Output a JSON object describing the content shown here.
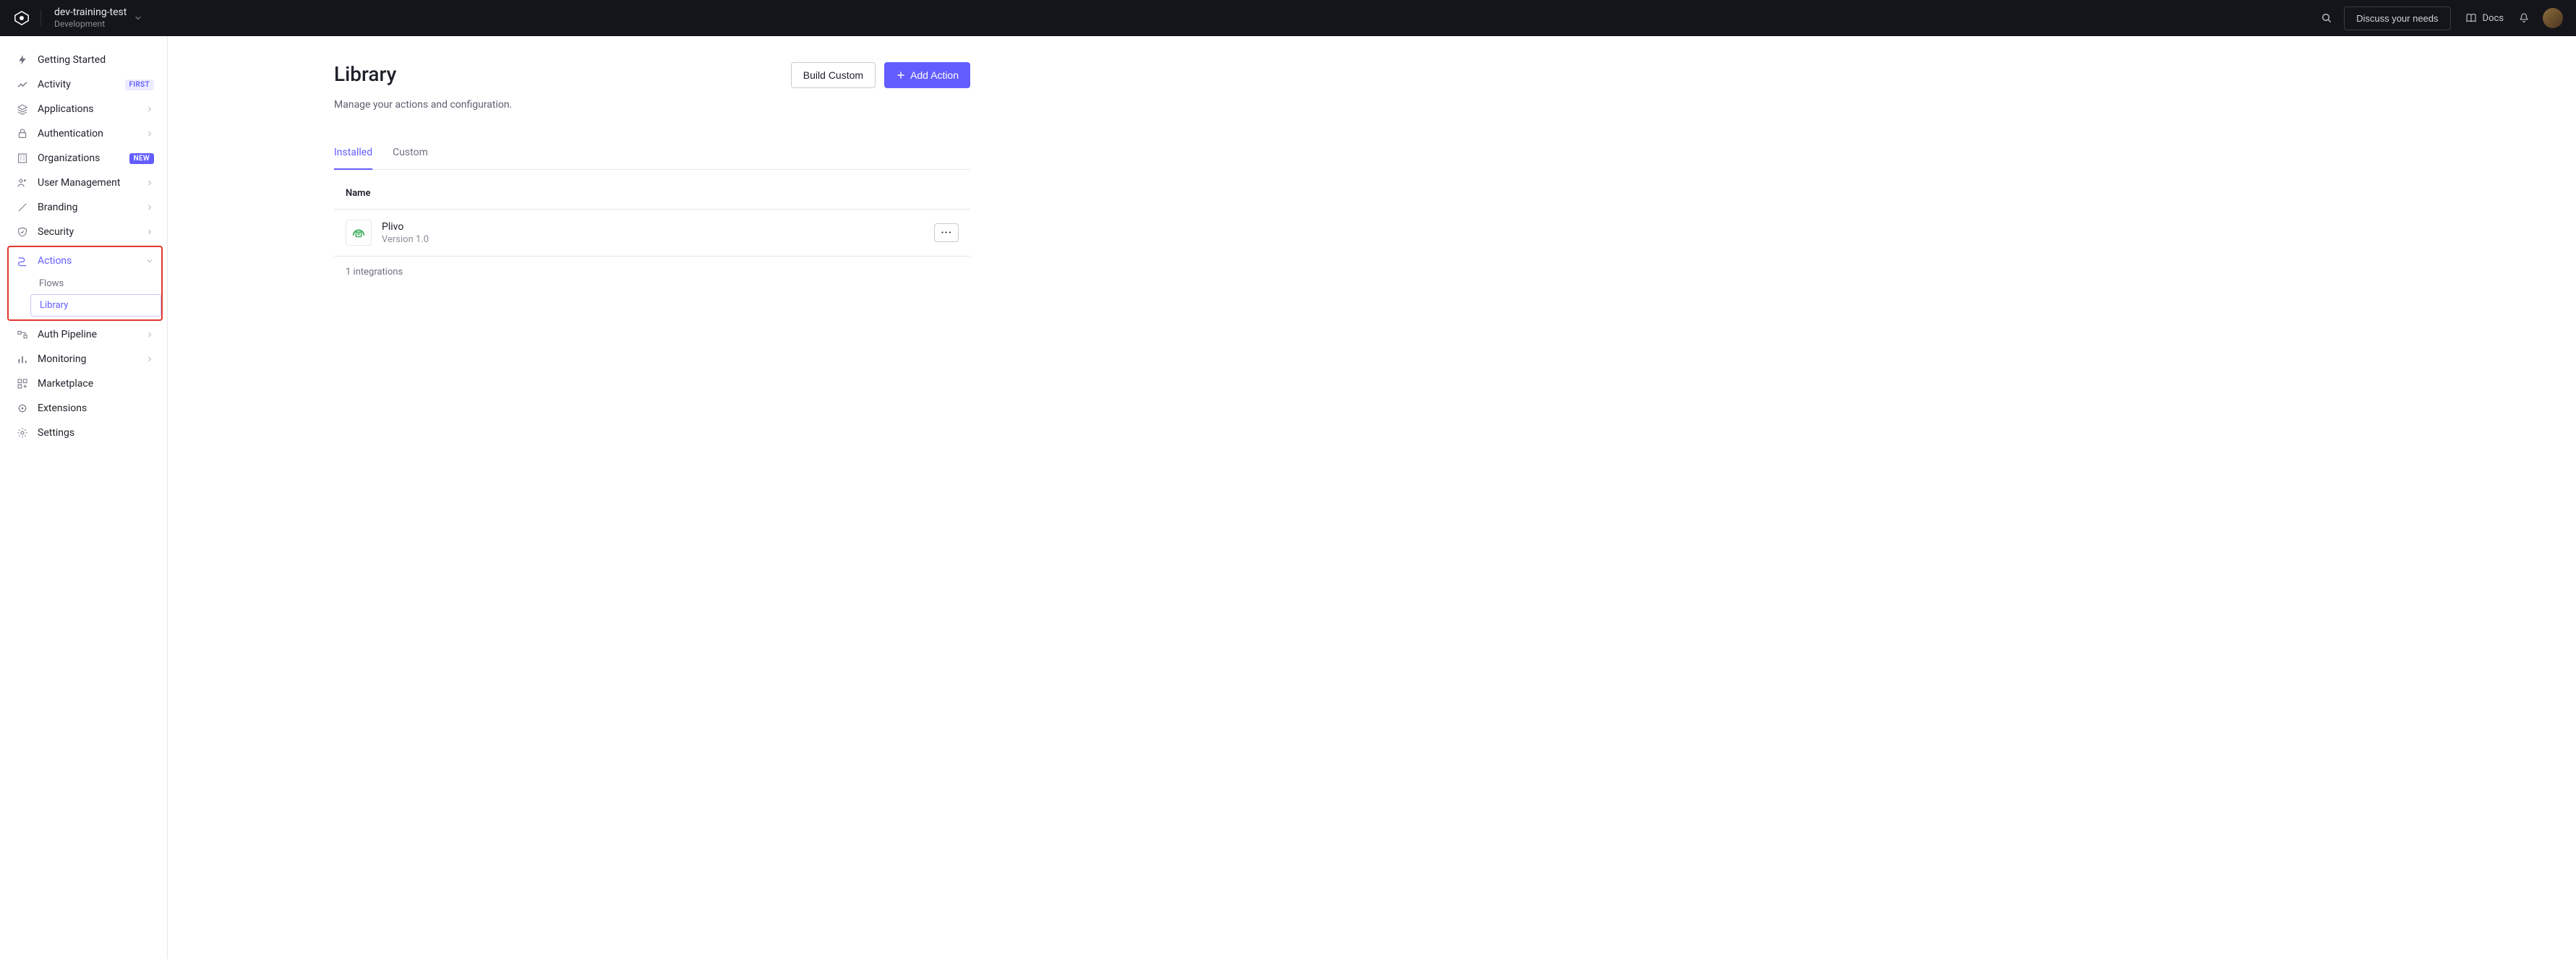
{
  "header": {
    "tenant_name": "dev-training-test",
    "tenant_env": "Development",
    "discuss_label": "Discuss your needs",
    "docs_label": "Docs"
  },
  "sidebar": {
    "getting_started": "Getting Started",
    "activity": "Activity",
    "activity_badge": "FIRST",
    "applications": "Applications",
    "authentication": "Authentication",
    "organizations": "Organizations",
    "organizations_badge": "NEW",
    "user_management": "User Management",
    "branding": "Branding",
    "security": "Security",
    "actions": "Actions",
    "actions_sub": {
      "flows": "Flows",
      "library": "Library"
    },
    "auth_pipeline": "Auth Pipeline",
    "monitoring": "Monitoring",
    "marketplace": "Marketplace",
    "extensions": "Extensions",
    "settings": "Settings"
  },
  "page": {
    "title": "Library",
    "subtitle": "Manage your actions and configuration.",
    "build_custom": "Build Custom",
    "add_action": "Add Action",
    "tabs": {
      "installed": "Installed",
      "custom": "Custom"
    },
    "table_header_name": "Name",
    "item": {
      "name": "Plivo",
      "version": "Version 1.0"
    },
    "footer": "1 integrations"
  }
}
